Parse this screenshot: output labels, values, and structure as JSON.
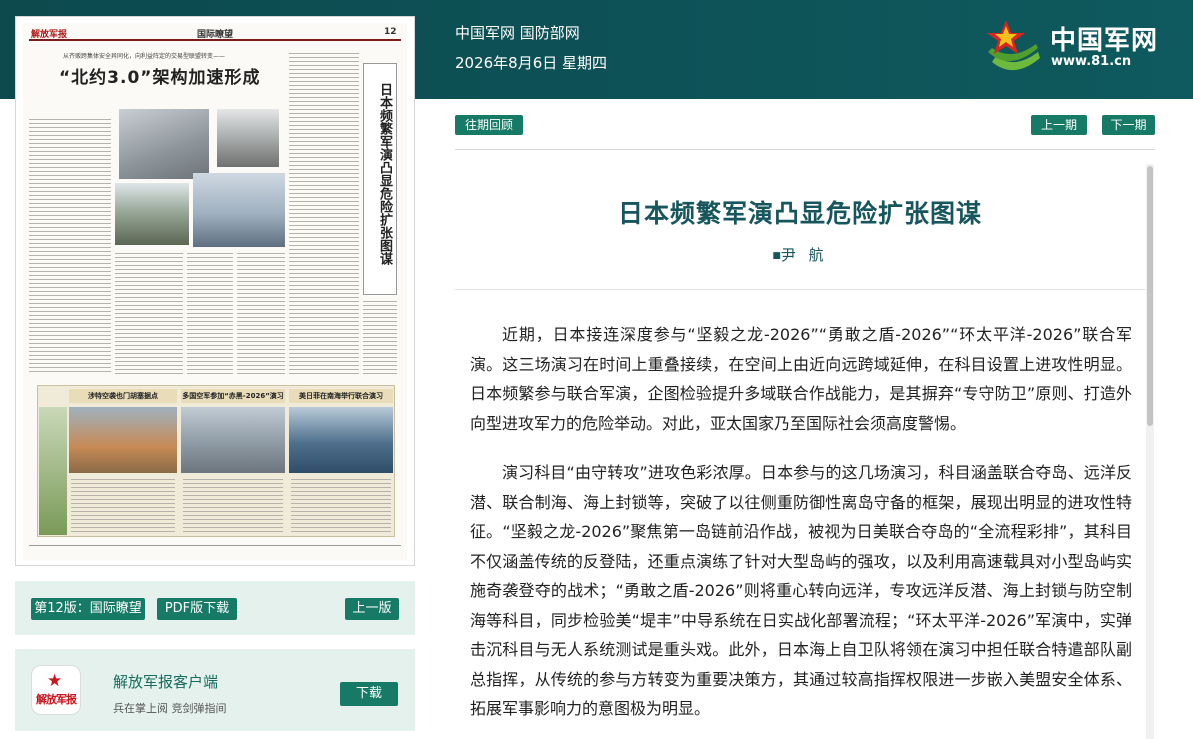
{
  "header": {
    "site_name": "中国军网 国防部网",
    "date": "2026年8月6日 星期四",
    "logo_cn": "中国军网",
    "logo_url": "www.81.cn"
  },
  "newspaper": {
    "brand": "解放军报",
    "section": "国际瞭望",
    "page_no": "12",
    "kicker": "从齐贩跨集体安全异同化，向利益阵定的交易型联盟转变——",
    "headline": "“北约3.0”架构加速形成",
    "side_title": "日本频繁军演凸显危险扩张图谋",
    "band_titles": [
      "涉特空袭也门胡塞据点",
      "多国空军参加“赤黑-2026”演习",
      "美日菲在南海举行联合演习"
    ]
  },
  "edition_bar": {
    "edition_label": "第12版：国际瞭望",
    "pdf_label": "PDF版下载",
    "prev_edition_label": "上一版"
  },
  "app_promo": {
    "icon_text": "解放军报",
    "title": "解放军报客户端",
    "subtitle": "兵在掌上阅 竞剑弹指间",
    "download_label": "下载"
  },
  "nav": {
    "archive_label": "往期回顾",
    "prev_issue_label": "上一期",
    "next_issue_label": "下一期"
  },
  "article": {
    "title": "日本频繁军演凸显危险扩张图谋",
    "author_mark": "■",
    "author": "尹 航",
    "paragraphs": [
      "近期，日本接连深度参与“坚毅之龙-2026”“勇敢之盾-2026”“环太平洋-2026”联合军演。这三场演习在时间上重叠接续，在空间上由近向远跨域延伸，在科目设置上进攻性明显。日本频繁参与联合军演，企图检验提升多域联合作战能力，是其摒弃“专守防卫”原则、打造外向型进攻军力的危险举动。对此，亚太国家乃至国际社会须高度警惕。",
      "演习科目“由守转攻”进攻色彩浓厚。日本参与的这几场演习，科目涵盖联合夺岛、远洋反潜、联合制海、海上封锁等，突破了以往侧重防御性离岛守备的框架，展现出明显的进攻性特征。“坚毅之龙-2026”聚焦第一岛链前沿作战，被视为日美联合夺岛的“全流程彩排”，其科目不仅涵盖传统的反登陆，还重点演练了针对大型岛屿的强攻，以及利用高速载具对小型岛屿实施奇袭登夺的战术；“勇敢之盾-2026”则将重心转向远洋，专攻远洋反潜、海上封锁与防空制海等科目，同步检验美“堤丰”中导系统在日实战化部署流程；“环太平洋-2026”军演中，实弹击沉科目与无人系统测试是重头戏。此外，日本海上自卫队将领在演习中担任联合特遣部队副总指挥，从传统的参与方转变为重要决策方，其通过较高指挥权限进一步嵌入美盟安全体系、拓展军事影响力的意图极为明显。"
    ]
  },
  "colors": {
    "header_bg": "#0d5257",
    "button_green": "#167a66",
    "title_teal": "#16565c",
    "panel_bg": "#e4f1ec"
  }
}
